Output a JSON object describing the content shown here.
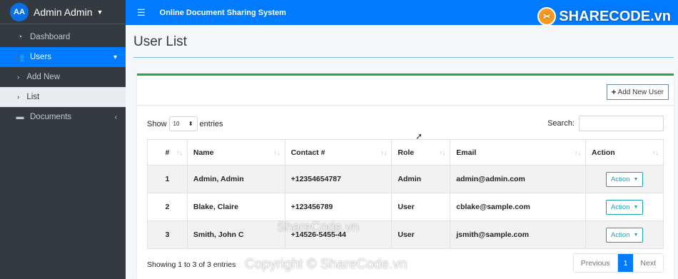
{
  "sidebar": {
    "avatar_initials": "AA",
    "user_name": "Admin Admin",
    "items": {
      "dashboard": "Dashboard",
      "users": "Users",
      "add_new": "Add New",
      "list": "List",
      "documents": "Documents"
    }
  },
  "topbar": {
    "title": "Online Document Sharing System"
  },
  "page": {
    "title": "User List"
  },
  "card": {
    "add_button": "Add New User",
    "show_label": "Show",
    "entries_value": "10",
    "entries_label": "entries",
    "search_label": "Search:"
  },
  "table": {
    "headers": [
      "#",
      "Name",
      "Contact #",
      "Role",
      "Email",
      "Action"
    ],
    "rows": [
      {
        "num": "1",
        "name": "Admin, Admin",
        "contact": "+12354654787",
        "role": "Admin",
        "email": "admin@admin.com",
        "action": "Action"
      },
      {
        "num": "2",
        "name": "Blake, Claire",
        "contact": "+123456789",
        "role": "User",
        "email": "cblake@sample.com",
        "action": "Action"
      },
      {
        "num": "3",
        "name": "Smith, John C",
        "contact": "+14526-5455-44",
        "role": "User",
        "email": "jsmith@sample.com",
        "action": "Action"
      }
    ]
  },
  "footer": {
    "info": "Showing 1 to 3 of 3 entries",
    "previous": "Previous",
    "current_page": "1",
    "next": "Next"
  },
  "watermarks": {
    "logo": "SHARECODE.vn",
    "center": "ShareCode.vn",
    "bottom": "Copyright © ShareCode.vn"
  },
  "colors": {
    "primary": "#007bff",
    "sidebar": "#343a40",
    "card_accent": "#28a745",
    "action": "#17a2b8"
  }
}
